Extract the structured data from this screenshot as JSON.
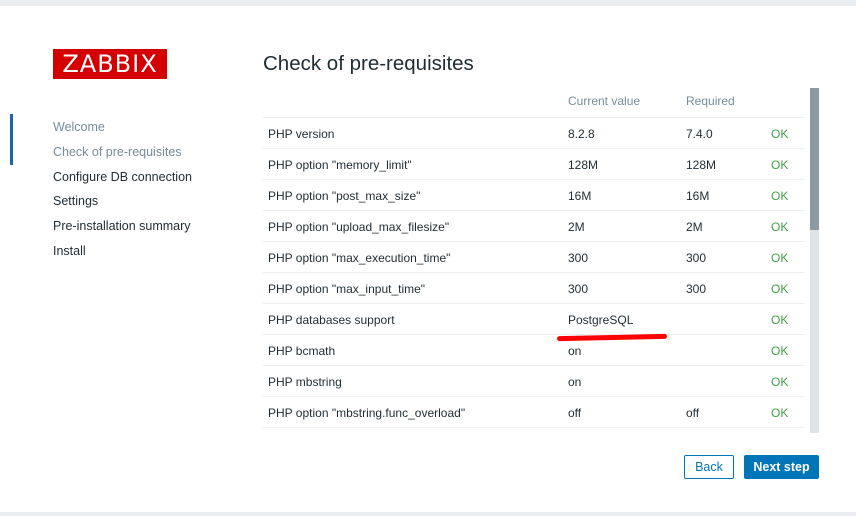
{
  "logo": {
    "text": "ZABBIX"
  },
  "steps": [
    {
      "label": "Welcome",
      "state": "done"
    },
    {
      "label": "Check of pre-requisites",
      "state": "current"
    },
    {
      "label": "Configure DB connection",
      "state": "pending"
    },
    {
      "label": "Settings",
      "state": "pending"
    },
    {
      "label": "Pre-installation summary",
      "state": "pending"
    },
    {
      "label": "Install",
      "state": "pending"
    }
  ],
  "page": {
    "title": "Check of pre-requisites"
  },
  "table": {
    "headers": {
      "current": "Current value",
      "required": "Required"
    },
    "rows": [
      {
        "name": "PHP version",
        "current": "8.2.8",
        "required": "7.4.0",
        "status": "OK"
      },
      {
        "name": "PHP option \"memory_limit\"",
        "current": "128M",
        "required": "128M",
        "status": "OK"
      },
      {
        "name": "PHP option \"post_max_size\"",
        "current": "16M",
        "required": "16M",
        "status": "OK"
      },
      {
        "name": "PHP option \"upload_max_filesize\"",
        "current": "2M",
        "required": "2M",
        "status": "OK"
      },
      {
        "name": "PHP option \"max_execution_time\"",
        "current": "300",
        "required": "300",
        "status": "OK"
      },
      {
        "name": "PHP option \"max_input_time\"",
        "current": "300",
        "required": "300",
        "status": "OK"
      },
      {
        "name": "PHP databases support",
        "current": "PostgreSQL",
        "required": "",
        "status": "OK"
      },
      {
        "name": "PHP bcmath",
        "current": "on",
        "required": "",
        "status": "OK"
      },
      {
        "name": "PHP mbstring",
        "current": "on",
        "required": "",
        "status": "OK"
      },
      {
        "name": "PHP option \"mbstring.func_overload\"",
        "current": "off",
        "required": "off",
        "status": "OK"
      }
    ]
  },
  "buttons": {
    "back": "Back",
    "next": "Next step"
  },
  "colors": {
    "brand": "#d40000",
    "accent": "#0275b8",
    "ok": "#429e47",
    "annotation": "#ff0000"
  }
}
